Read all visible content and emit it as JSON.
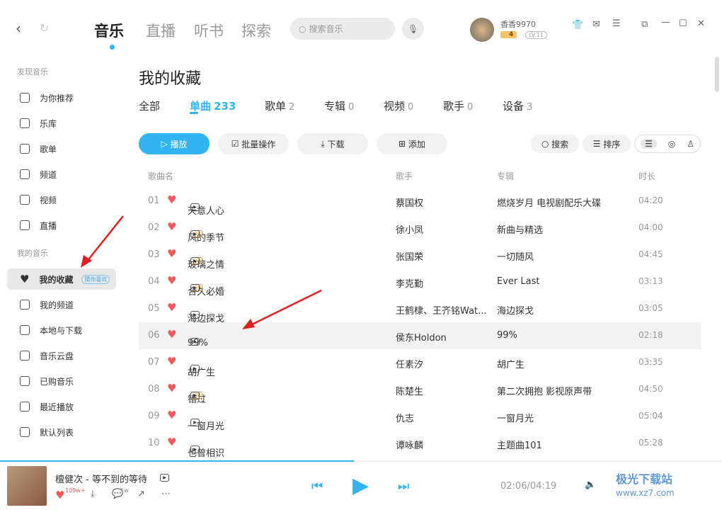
{
  "nav": {
    "tabs": [
      "音乐",
      "直播",
      "听书",
      "探索"
    ],
    "search_placeholder": "搜索音乐"
  },
  "user": {
    "name": "香香9970",
    "vip_level": "4",
    "level": "LV.11"
  },
  "sidebar": {
    "section1": "发现音乐",
    "items1": [
      "为你推荐",
      "乐库",
      "歌单",
      "频道",
      "视频",
      "直播"
    ],
    "section2": "我的音乐",
    "items2": [
      "我的收藏",
      "我的频道",
      "本地与下载",
      "音乐云盘",
      "已购音乐",
      "最近播放",
      "默认列表"
    ],
    "badge": "猜你喜欢"
  },
  "page": {
    "title": "我的收藏",
    "tabs": [
      {
        "label": "全部",
        "count": ""
      },
      {
        "label": "单曲",
        "count": "233"
      },
      {
        "label": "歌单",
        "count": "2"
      },
      {
        "label": "专辑",
        "count": "0"
      },
      {
        "label": "视频",
        "count": "0"
      },
      {
        "label": "歌手",
        "count": "0"
      },
      {
        "label": "设备",
        "count": "3"
      }
    ]
  },
  "toolbar": {
    "play": "播放",
    "batch": "批量操作",
    "download": "下载",
    "add": "添加",
    "search": "搜索",
    "sort": "排序"
  },
  "table": {
    "headers": [
      "歌曲名",
      "歌手",
      "专辑",
      "时长"
    ],
    "rows": [
      {
        "num": "01",
        "title": "天意人心",
        "vip": false,
        "artist": "蔡国权",
        "album": "燃烧岁月 电视剧配乐大碟",
        "duration": "04:20"
      },
      {
        "num": "02",
        "title": "风的季节",
        "vip": true,
        "artist": "徐小凤",
        "album": "新曲与精选",
        "duration": "04:00"
      },
      {
        "num": "03",
        "title": "玻璃之情",
        "vip": true,
        "artist": "张国荣",
        "album": "一切随风",
        "duration": "04:45"
      },
      {
        "num": "04",
        "title": "合久必婚",
        "vip": true,
        "artist": "李克勤",
        "album": "Ever Last",
        "duration": "03:13"
      },
      {
        "num": "05",
        "title": "海边探戈",
        "vip": false,
        "artist": "王鹤棣、王齐铭Wat...",
        "album": "海边探戈",
        "duration": "03:05"
      },
      {
        "num": "06",
        "title": "99%",
        "vip": false,
        "artist": "侯东Holdon",
        "album": "99%",
        "duration": "02:18"
      },
      {
        "num": "07",
        "title": "胡广生",
        "vip": false,
        "artist": "任素汐",
        "album": "胡广生",
        "duration": "03:35"
      },
      {
        "num": "08",
        "title": "错过",
        "vip": true,
        "artist": "陈楚生",
        "album": "第二次拥抱 影视原声带",
        "duration": "04:50"
      },
      {
        "num": "09",
        "title": "一窗月光",
        "vip": false,
        "artist": "仇志",
        "album": "一窗月光",
        "duration": "05:04"
      },
      {
        "num": "10",
        "title": "也曾相识",
        "vip": false,
        "artist": "谭咏麟",
        "album": "主题曲101",
        "duration": "05:28"
      }
    ]
  },
  "player": {
    "track": "檀健次 - 等不到的等待",
    "likes": "109w+",
    "comments": "1w",
    "time": "02:06/04:19",
    "progress": 0.49
  },
  "watermark": {
    "text": "极光下载站",
    "url": "www.xz7.com"
  },
  "colors": {
    "accent": "#31b4f0",
    "heart": "#f25a5a"
  }
}
